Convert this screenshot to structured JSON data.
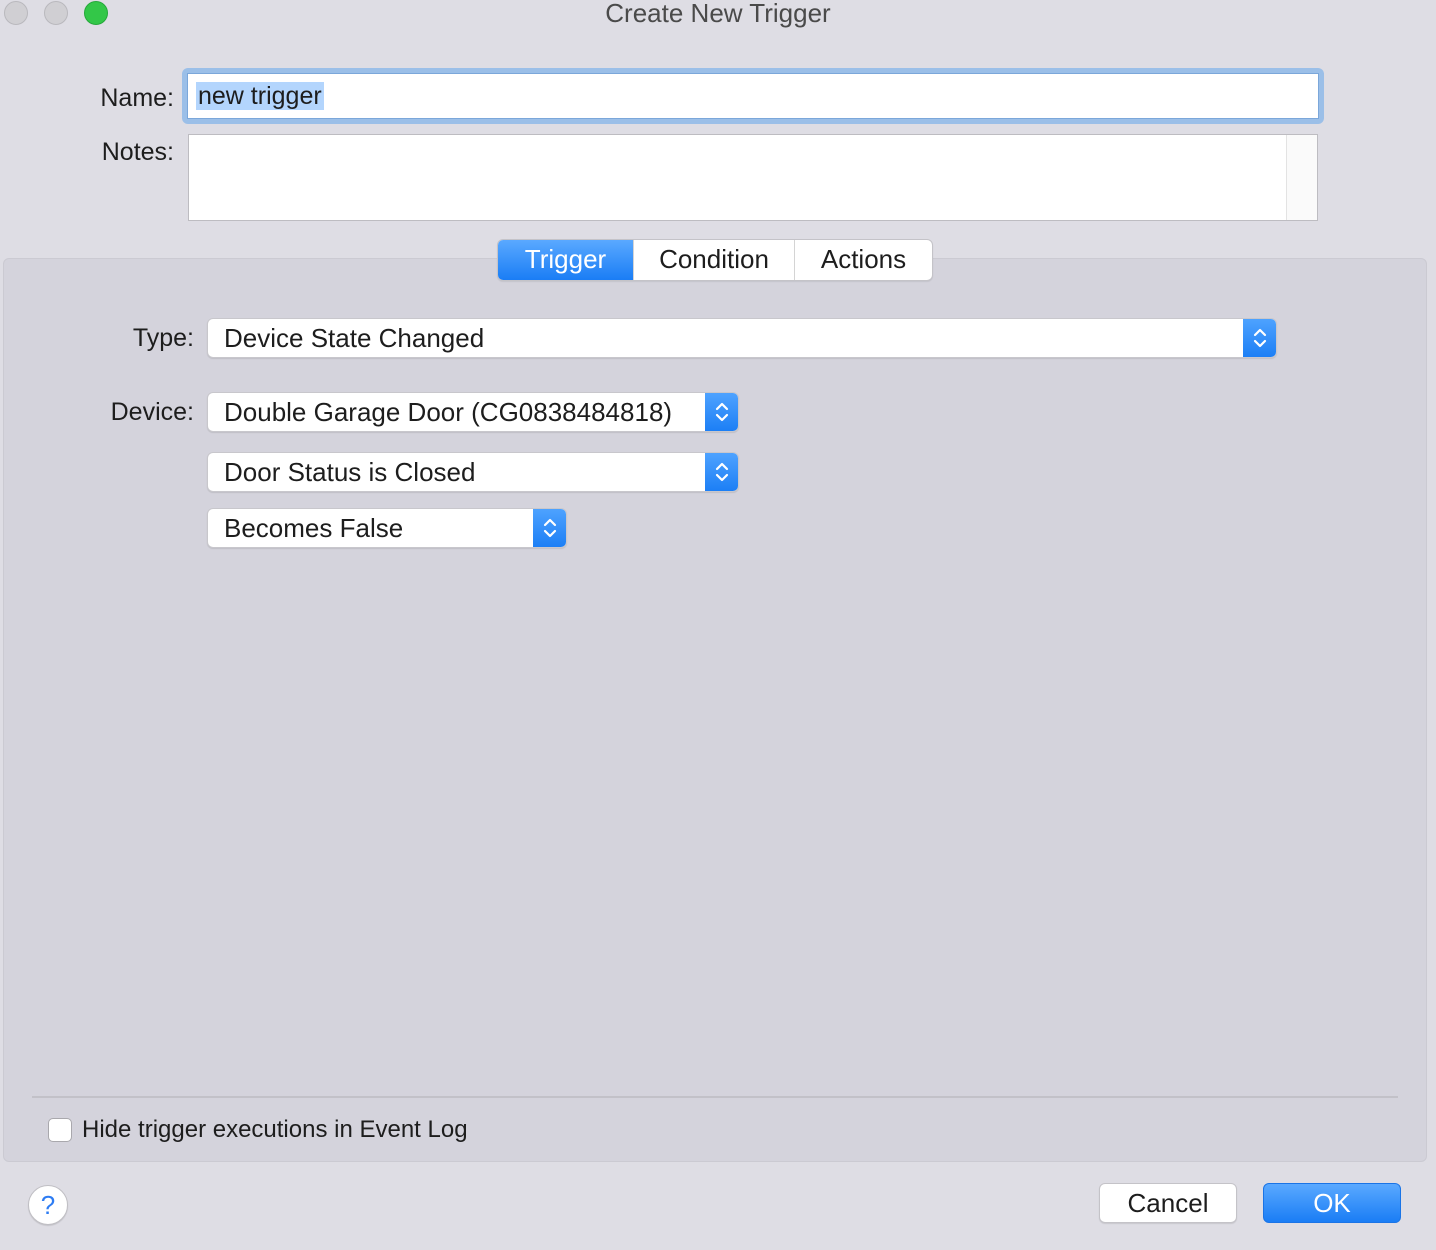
{
  "window": {
    "title": "Create New Trigger"
  },
  "form": {
    "name_label": "Name:",
    "name_value": "new trigger",
    "notes_label": "Notes:",
    "notes_value": ""
  },
  "tabs": [
    {
      "label": "Trigger",
      "active": true
    },
    {
      "label": "Condition",
      "active": false
    },
    {
      "label": "Actions",
      "active": false
    }
  ],
  "trigger": {
    "type_label": "Type:",
    "type_value": "Device State Changed",
    "device_label": "Device:",
    "device_value": "Double Garage Door (CG0838484818)",
    "state_value": "Door Status is Closed",
    "transition_value": "Becomes False"
  },
  "footer": {
    "hide_executions_label": "Hide trigger executions in Event Log",
    "hide_executions_checked": false,
    "help_label": "?",
    "cancel_label": "Cancel",
    "ok_label": "OK"
  },
  "colors": {
    "accent": "#1a7df5",
    "zoom_button": "#33c748"
  }
}
